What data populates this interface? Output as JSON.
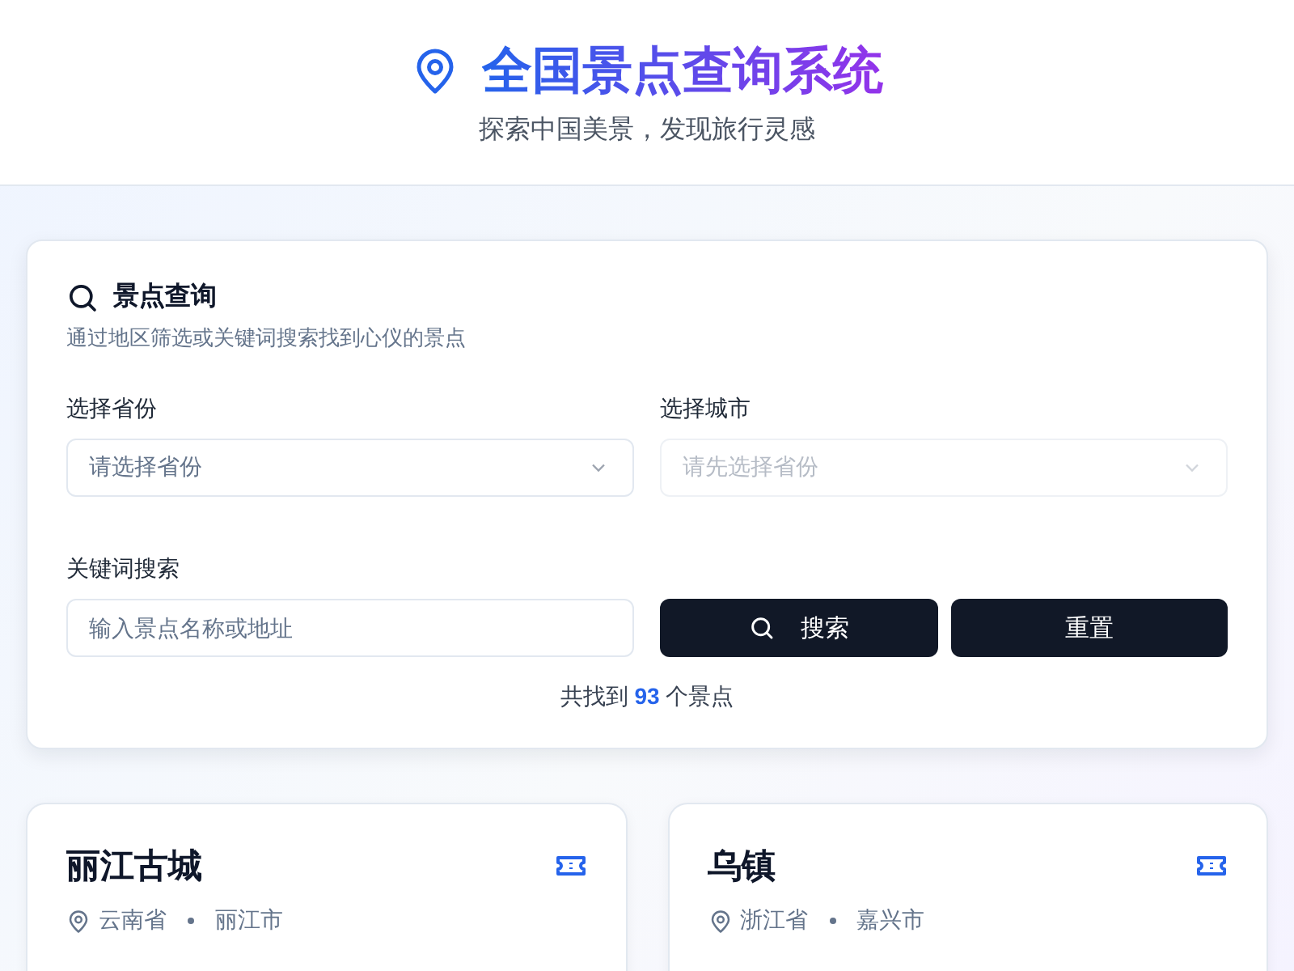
{
  "header": {
    "title": "全国景点查询系统",
    "subtitle": "探索中国美景，发现旅行灵感"
  },
  "search_panel": {
    "title": "景点查询",
    "description": "通过地区筛选或关键词搜索找到心仪的景点",
    "province": {
      "label": "选择省份",
      "placeholder": "请选择省份",
      "disabled": false
    },
    "city": {
      "label": "选择城市",
      "placeholder": "请先选择省份",
      "disabled": true
    },
    "keyword": {
      "label": "关键词搜索",
      "placeholder": "输入景点名称或地址"
    },
    "buttons": [
      {
        "kind": "search",
        "label": "搜索"
      },
      {
        "kind": "reset",
        "label": "重置"
      }
    ],
    "result": {
      "prefix": "共找到",
      "count": "93",
      "suffix": "个景点"
    }
  },
  "spots": [
    {
      "name": "丽江古城",
      "province": "云南省",
      "city": "丽江市"
    },
    {
      "name": "乌镇",
      "province": "浙江省",
      "city": "嘉兴市"
    }
  ]
}
